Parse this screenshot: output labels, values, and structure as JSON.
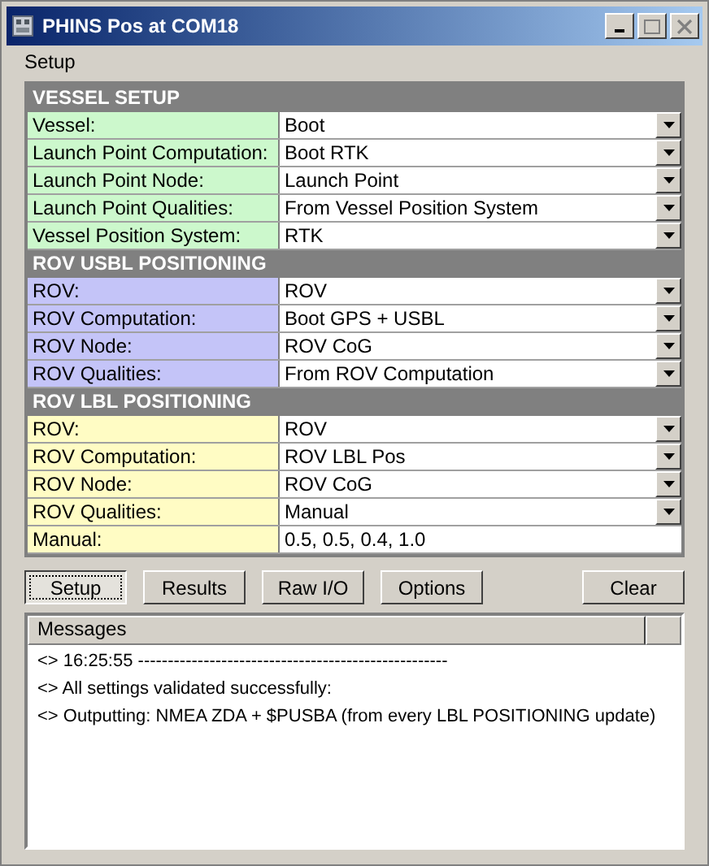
{
  "window": {
    "title": "PHINS Pos at COM18"
  },
  "menu": [
    "Setup"
  ],
  "sections": [
    {
      "title": "VESSEL SETUP",
      "color": "#ccf8cc",
      "rows": [
        {
          "kind": "dropdown",
          "label": "Vessel:",
          "value": "Boot"
        },
        {
          "kind": "dropdown",
          "label": "Launch Point Computation:",
          "value": "Boot RTK"
        },
        {
          "kind": "dropdown",
          "label": "Launch Point Node:",
          "value": "Launch Point"
        },
        {
          "kind": "dropdown",
          "label": "Launch Point Qualities:",
          "value": "From Vessel Position System"
        },
        {
          "kind": "dropdown",
          "label": "Vessel Position System:",
          "value": "RTK"
        }
      ]
    },
    {
      "title": "ROV USBL POSITIONING",
      "color": "#c4c4f8",
      "rows": [
        {
          "kind": "dropdown",
          "label": "ROV:",
          "value": "ROV"
        },
        {
          "kind": "dropdown",
          "label": "ROV Computation:",
          "value": "Boot GPS + USBL"
        },
        {
          "kind": "dropdown",
          "label": "ROV Node:",
          "value": "ROV CoG"
        },
        {
          "kind": "dropdown",
          "label": "ROV Qualities:",
          "value": "From ROV Computation"
        }
      ]
    },
    {
      "title": "ROV LBL POSITIONING",
      "color": "#fffcc4",
      "rows": [
        {
          "kind": "dropdown",
          "label": "ROV:",
          "value": "ROV"
        },
        {
          "kind": "dropdown",
          "label": "ROV Computation:",
          "value": "ROV LBL Pos"
        },
        {
          "kind": "dropdown",
          "label": "ROV Node:",
          "value": "ROV CoG"
        },
        {
          "kind": "dropdown",
          "label": "ROV Qualities:",
          "value": "Manual"
        },
        {
          "kind": "text",
          "label": "Manual:",
          "value": "0.5, 0.5, 0.4, 1.0"
        }
      ]
    }
  ],
  "tabs": [
    {
      "label": "Setup",
      "selected": true
    },
    {
      "label": "Results",
      "selected": false
    },
    {
      "label": "Raw I/O",
      "selected": false
    },
    {
      "label": "Options",
      "selected": false
    }
  ],
  "clear_button": "Clear",
  "messages": {
    "header": "Messages",
    "lines": [
      "<> 16:25:55 ----------------------------------------------------",
      "<> All settings validated successfully:",
      "<> Outputting: NMEA ZDA + $PUSBA (from every LBL POSITIONING update)"
    ]
  }
}
